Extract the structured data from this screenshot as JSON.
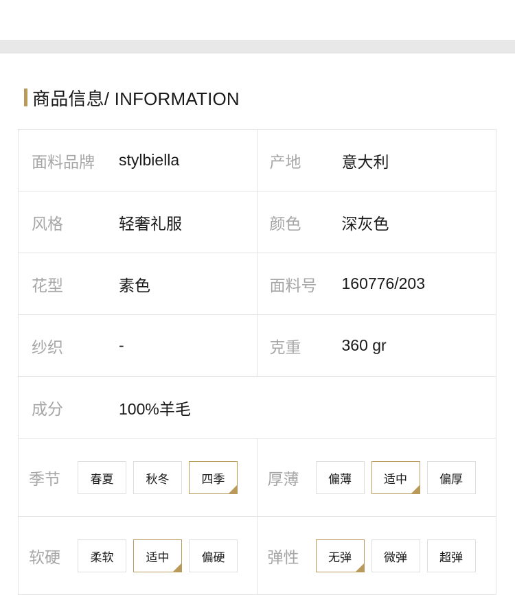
{
  "section": {
    "title": "商品信息/ INFORMATION"
  },
  "colors": {
    "accent": "#b99a5a",
    "border": "#e3e3e3",
    "label": "#a6a6a6",
    "band": "#e8e8e8"
  },
  "specs": {
    "fabric_brand": {
      "label": "面料品牌",
      "value": "stylbiella"
    },
    "origin": {
      "label": "产地",
      "value": "意大利"
    },
    "style": {
      "label": "风格",
      "value": "轻奢礼服"
    },
    "color": {
      "label": "颜色",
      "value": "深灰色"
    },
    "pattern": {
      "label": "花型",
      "value": "素色"
    },
    "fabric_no": {
      "label": "面料号",
      "value": "160776/203"
    },
    "weave": {
      "label": "纱织",
      "value": "-"
    },
    "weight": {
      "label": "克重",
      "value": "360 gr"
    },
    "composition": {
      "label": "成分",
      "value": "100%羊毛"
    }
  },
  "options": {
    "season": {
      "label": "季节",
      "items": [
        "春夏",
        "秋冬",
        "四季"
      ],
      "selected": "四季"
    },
    "thickness": {
      "label": "厚薄",
      "items": [
        "偏薄",
        "适中",
        "偏厚"
      ],
      "selected": "适中"
    },
    "softness": {
      "label": "软硬",
      "items": [
        "柔软",
        "适中",
        "偏硬"
      ],
      "selected": "适中"
    },
    "elasticity": {
      "label": "弹性",
      "items": [
        "无弹",
        "微弹",
        "超弹"
      ],
      "selected": "无弹"
    }
  }
}
